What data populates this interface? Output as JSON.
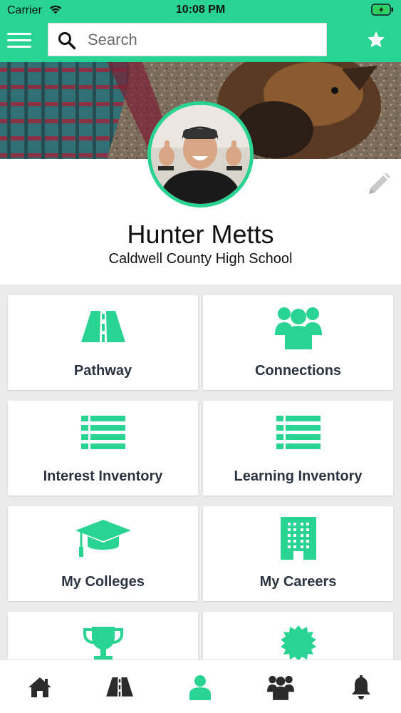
{
  "status_bar": {
    "carrier": "Carrier",
    "time": "10:08 PM"
  },
  "search": {
    "placeholder": "Search"
  },
  "profile": {
    "name": "Hunter Metts",
    "school": "Caldwell County High School"
  },
  "tiles": [
    {
      "label": "Pathway",
      "icon": "road-icon"
    },
    {
      "label": "Connections",
      "icon": "people-group-icon"
    },
    {
      "label": "Interest Inventory",
      "icon": "list-icon"
    },
    {
      "label": "Learning Inventory",
      "icon": "list-icon"
    },
    {
      "label": "My Colleges",
      "icon": "graduation-cap-icon"
    },
    {
      "label": "My Careers",
      "icon": "building-icon"
    },
    {
      "label": "",
      "icon": "trophy-icon"
    },
    {
      "label": "",
      "icon": "badge-icon"
    }
  ],
  "tab_bar": {
    "items": [
      "home-icon",
      "road-icon",
      "user-icon",
      "people-group-icon",
      "bell-icon"
    ],
    "active": "user-icon"
  },
  "colors": {
    "accent": "#29d492",
    "text": "#2b3440",
    "icon_dark": "#2b2b2b"
  }
}
